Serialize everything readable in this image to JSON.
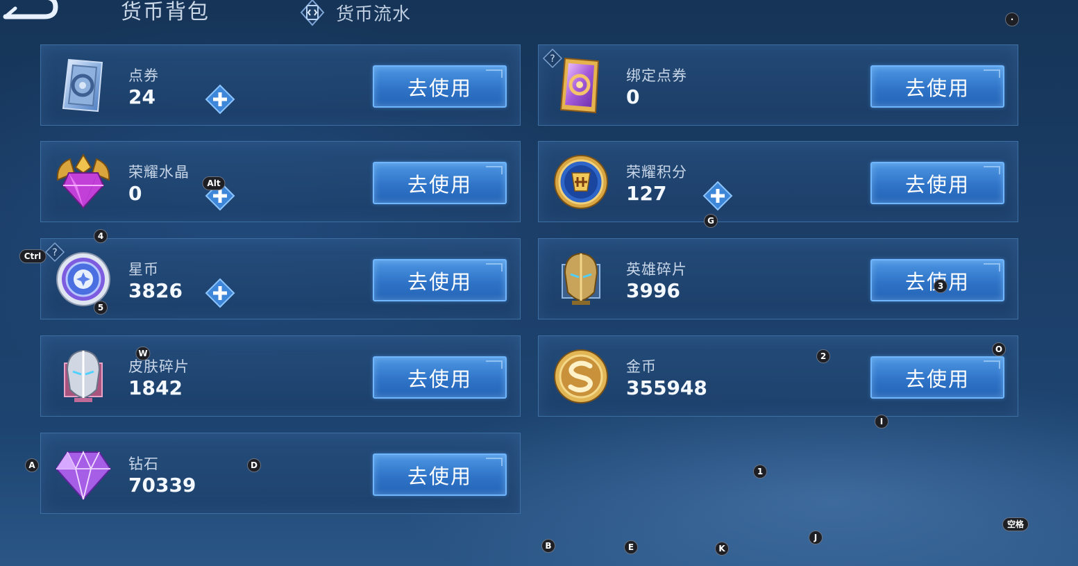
{
  "header": {
    "title": "货币背包",
    "flow_tab_label": "货币流水"
  },
  "cards": [
    {
      "name": "点券",
      "amount": "24",
      "button": "去使用",
      "icon": "coupon-icon",
      "has_plus": true,
      "has_help": false
    },
    {
      "name": "绑定点券",
      "amount": "0",
      "button": "去使用",
      "icon": "bound-coupon-icon",
      "has_plus": false,
      "has_help": true
    },
    {
      "name": "荣耀水晶",
      "amount": "0",
      "button": "去使用",
      "icon": "glory-crystal-icon",
      "has_plus": true,
      "has_help": false
    },
    {
      "name": "荣耀积分",
      "amount": "127",
      "button": "去使用",
      "icon": "glory-points-icon",
      "has_plus": true,
      "has_help": false
    },
    {
      "name": "星币",
      "amount": "3826",
      "button": "去使用",
      "icon": "star-coin-icon",
      "has_plus": true,
      "has_help": true
    },
    {
      "name": "英雄碎片",
      "amount": "3996",
      "button": "去使用",
      "icon": "hero-fragment-icon",
      "has_plus": false,
      "has_help": false
    },
    {
      "name": "皮肤碎片",
      "amount": "1842",
      "button": "去使用",
      "icon": "skin-fragment-icon",
      "has_plus": false,
      "has_help": false
    },
    {
      "name": "金币",
      "amount": "355948",
      "button": "去使用",
      "icon": "gold-coin-icon",
      "has_plus": false,
      "has_help": false
    },
    {
      "name": "钻石",
      "amount": "70339",
      "button": "去使用",
      "icon": "diamond-icon",
      "has_plus": false,
      "has_help": false
    }
  ],
  "key_hints": [
    "4",
    "Ctrl",
    "Alt",
    "5",
    "G",
    "3",
    "W",
    "2",
    "O",
    "I",
    "A",
    "D",
    "1",
    "空格",
    "B",
    "E",
    "K",
    "J",
    "·"
  ],
  "colors": {
    "background": "#1b3d66",
    "card_border": "#3e6fa3",
    "button_fill": "#2f74c8",
    "button_border": "#6fb6ff",
    "plus_fill": "#3d86d8"
  }
}
